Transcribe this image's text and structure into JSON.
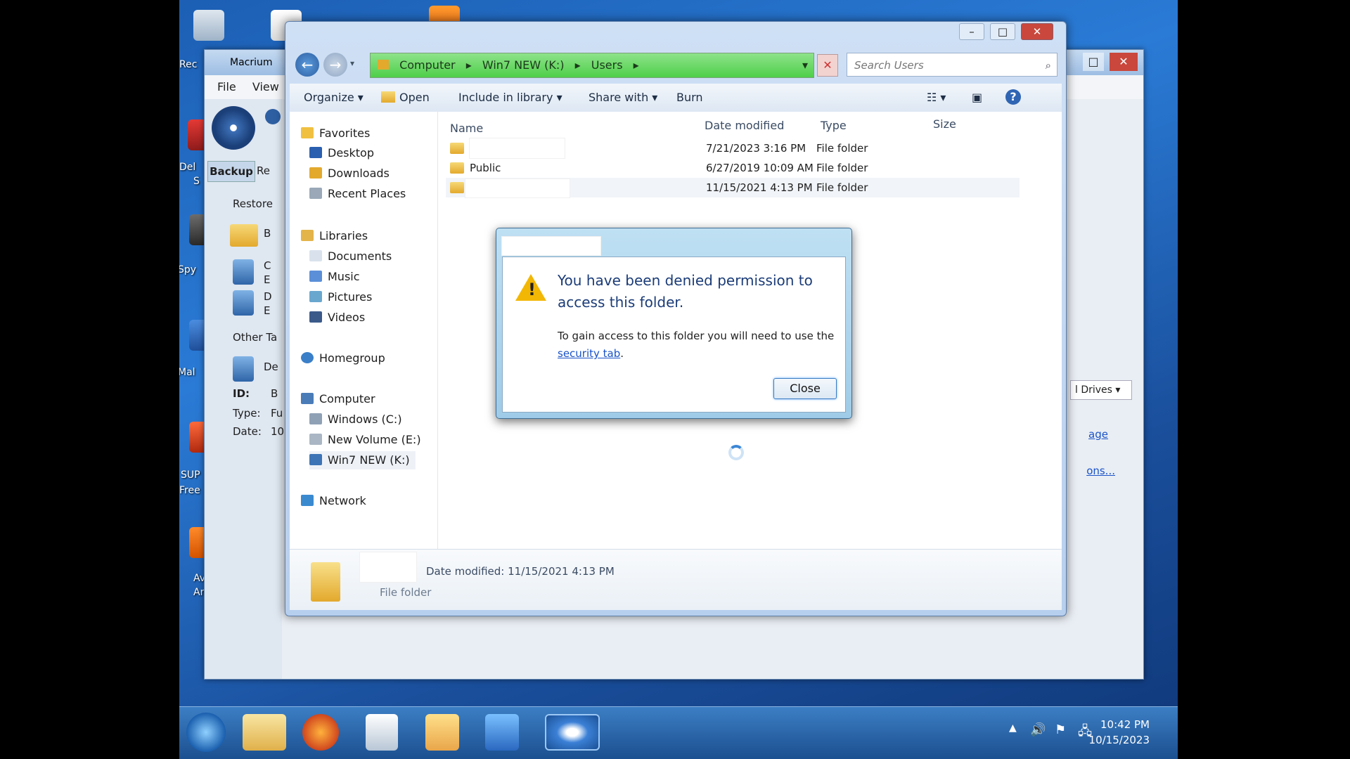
{
  "desktop": {
    "icon_labels": [
      "Rec",
      "Del",
      "S",
      "Spy",
      "Mal",
      "SUP",
      "Free",
      "Av",
      "Ar"
    ]
  },
  "macrium": {
    "title": "Macrium",
    "menu": [
      "File",
      "View"
    ],
    "tabs": [
      "Backup",
      "Re"
    ],
    "sections": [
      "Restore",
      "Other Ta",
      "De"
    ],
    "item_letters": [
      "B",
      "C",
      "E",
      "D",
      "E"
    ],
    "info_labels": [
      "ID:",
      "Type:",
      "Date:"
    ],
    "info_values": [
      "B",
      "Fu",
      "10"
    ],
    "right_dropdown": "l Drives",
    "right_links": [
      "age",
      "ons..."
    ]
  },
  "explorer": {
    "breadcrumb": [
      "Computer",
      "Win7 NEW (K:)",
      "Users"
    ],
    "search_placeholder": "Search Users",
    "toolbar": {
      "organize": "Organize",
      "open": "Open",
      "include_in_library": "Include in library",
      "share_with": "Share with",
      "burn": "Burn"
    },
    "nav": {
      "favorites": "Favorites",
      "desktop": "Desktop",
      "downloads": "Downloads",
      "recent_places": "Recent Places",
      "libraries": "Libraries",
      "documents": "Documents",
      "music": "Music",
      "pictures": "Pictures",
      "videos": "Videos",
      "homegroup": "Homegroup",
      "computer": "Computer",
      "windows_c": "Windows (C:)",
      "new_volume_e": "New Volume (E:)",
      "win7_new_k": "Win7 NEW (K:)",
      "network": "Network"
    },
    "columns": {
      "name": "Name",
      "date_modified": "Date modified",
      "type": "Type",
      "size": "Size"
    },
    "rows": [
      {
        "name": "",
        "date": "7/21/2023 3:16 PM",
        "type": "File folder"
      },
      {
        "name": "Public",
        "date": "6/27/2019 10:09 AM",
        "type": "File folder"
      },
      {
        "name": "",
        "date": "11/15/2021 4:13 PM",
        "type": "File folder"
      }
    ],
    "details": {
      "date_modified": "Date modified: 11/15/2021 4:13 PM",
      "type": "File folder"
    }
  },
  "dialog": {
    "title": "",
    "message": "You have been denied permission to access this folder.",
    "sub_text": "To gain access to this folder you will need to use the",
    "link": "security tab",
    "after_link": ".",
    "close_button": "Close"
  },
  "taskbar": {
    "time": "10:42 PM",
    "date": "10/15/2023"
  },
  "colors": {
    "address_bar": "#4fcf4a",
    "dialog_heading": "#1b3c78",
    "link": "#1a52c8",
    "warning": "#f2b705"
  }
}
